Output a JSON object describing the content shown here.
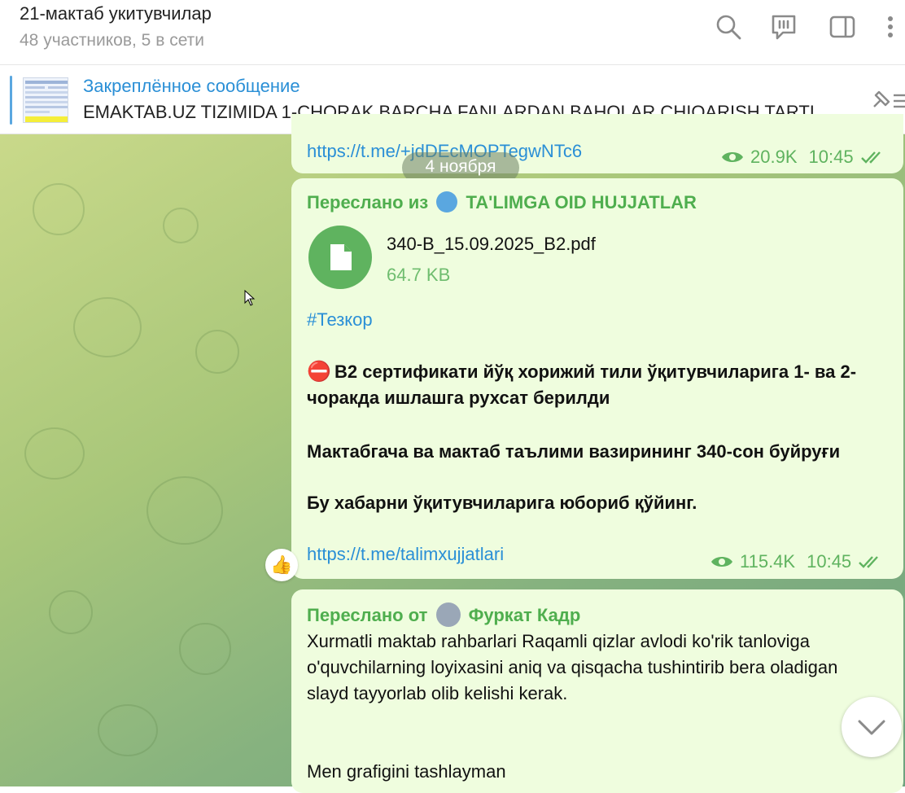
{
  "header": {
    "title": "21-мактаб укитувчилар",
    "subtitle": "48 участников, 5 в сети",
    "icons": [
      "search-icon",
      "topics-icon",
      "sidebar-toggle-icon",
      "more-icon"
    ]
  },
  "pinned": {
    "label": "Закреплённое сообщение",
    "text": "EMAKTAB.UZ TIZIMIDA 1-CHORAK BARCHA FANLARDAN BAHOLAR CHIQARISH TARTI...",
    "icon": "unpin-icon"
  },
  "date_divider": "4 ноября",
  "messages": [
    {
      "link": "https://t.me/+jdDEcMOPTegwNTc6",
      "views": "20.9K",
      "time": "10:45"
    },
    {
      "forward_prefix": "Переслано из",
      "forward_source": "TA'LIMGA OID HUJJATLAR",
      "file_name": "340-B_15.09.2025_B2.pdf",
      "file_size": "64.7 KB",
      "hashtag": "#Тезкор",
      "para1": "B2 сертификати йўқ хорижий тили ўқитувчиларига 1- ва 2-чоракда ишлашга рухсат берилди",
      "para2": "Мактабгача ва мактаб таълими вазирининг 340-сон буйруғи",
      "para3": "Бу хабарни ўқитувчиларига юбориб қўйинг.",
      "link": "https://t.me/talimxujjatlari",
      "views": "115.4K",
      "time": "10:45",
      "reaction": "👍"
    },
    {
      "forward_prefix": "Переслано от",
      "forward_source": "Фуркат Кадр",
      "text": "Xurmatli maktab rahbarlari  Raqamli qizlar avlodi ko'rik tanloviga o'quvchilarning loyixasini aniq va qisqacha tushintirib bera oladigan slayd tayyorlab olib kelishi kerak.",
      "text2": "Men grafigini tashlayman"
    }
  ],
  "colors": {
    "bubble": "#effdde",
    "accent_green": "#4fae4e",
    "link_blue": "#2a8fd6"
  }
}
